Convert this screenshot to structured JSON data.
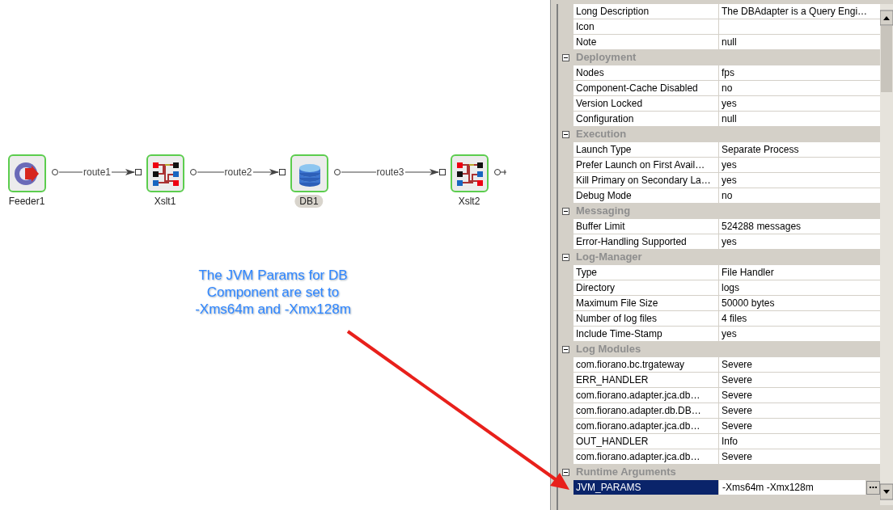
{
  "canvas": {
    "nodes": [
      {
        "label": "Feeder1",
        "kind": "feeder",
        "selected": false
      },
      {
        "label": "Xslt1",
        "kind": "xslt",
        "selected": false
      },
      {
        "label": "DB1",
        "kind": "db",
        "selected": true
      },
      {
        "label": "Xslt2",
        "kind": "xslt",
        "selected": false
      }
    ],
    "routes": [
      {
        "label": "route1"
      },
      {
        "label": "route2"
      },
      {
        "label": "route3"
      }
    ],
    "annotation": "The JVM Params for DB\nComponent are set to\n-Xms64m and -Xmx128m"
  },
  "properties": {
    "top_rows": [
      {
        "name": "Long Description",
        "value": "The DBAdapter is a Query Engi…",
        "selected": false
      },
      {
        "name": "Icon",
        "selected": false
      },
      {
        "name": "Note",
        "value": "null",
        "selected": false
      }
    ],
    "sections": [
      {
        "title": "Deployment",
        "expanded": true,
        "rows": [
          {
            "name": "Nodes",
            "value": "fps",
            "selected": false
          },
          {
            "name": "Component-Cache Disabled",
            "value": "no",
            "selected": false
          },
          {
            "name": "Version Locked",
            "value": "yes",
            "selected": false
          },
          {
            "name": "Configuration",
            "value": "null",
            "selected": false
          }
        ]
      },
      {
        "title": "Execution",
        "expanded": true,
        "rows": [
          {
            "name": "Launch Type",
            "value": "Separate Process",
            "selected": false
          },
          {
            "name": "Prefer Launch on First Avail…",
            "value": "yes",
            "selected": false
          },
          {
            "name": "Kill Primary on Secondary La…",
            "value": "yes",
            "selected": false
          },
          {
            "name": "Debug Mode",
            "value": "no",
            "selected": false
          }
        ]
      },
      {
        "title": "Messaging",
        "expanded": true,
        "rows": [
          {
            "name": "Buffer Limit",
            "value": "524288 messages",
            "selected": false
          },
          {
            "name": "Error-Handling Supported",
            "value": "yes",
            "selected": false
          }
        ]
      },
      {
        "title": "Log-Manager",
        "expanded": true,
        "rows": [
          {
            "name": "Type",
            "value": "File Handler",
            "selected": false
          },
          {
            "name": "Directory",
            "value": "logs",
            "selected": false
          },
          {
            "name": "Maximum File Size",
            "value": "50000 bytes",
            "selected": false
          },
          {
            "name": "Number of log files",
            "value": "4 files",
            "selected": false
          },
          {
            "name": "Include Time-Stamp",
            "value": "yes",
            "selected": false
          }
        ]
      },
      {
        "title": "Log Modules",
        "expanded": true,
        "rows": [
          {
            "name": "com.fiorano.bc.trgateway",
            "value": "Severe",
            "selected": false
          },
          {
            "name": "ERR_HANDLER",
            "value": "Severe",
            "selected": false
          },
          {
            "name": "com.fiorano.adapter.jca.db…",
            "value": "Severe",
            "selected": false
          },
          {
            "name": "com.fiorano.adapter.db.DB…",
            "value": "Severe",
            "selected": false
          },
          {
            "name": "com.fiorano.adapter.jca.db…",
            "value": "Severe",
            "selected": false
          },
          {
            "name": "OUT_HANDLER",
            "value": "Info",
            "selected": false
          },
          {
            "name": "com.fiorano.adapter.jca.db…",
            "value": "Severe",
            "selected": false
          }
        ]
      },
      {
        "title": "Runtime Arguments",
        "expanded": true,
        "rows": [
          {
            "name": "JVM_PARAMS",
            "value": "-Xms64m -Xmx128m",
            "selected": true
          }
        ]
      }
    ]
  }
}
